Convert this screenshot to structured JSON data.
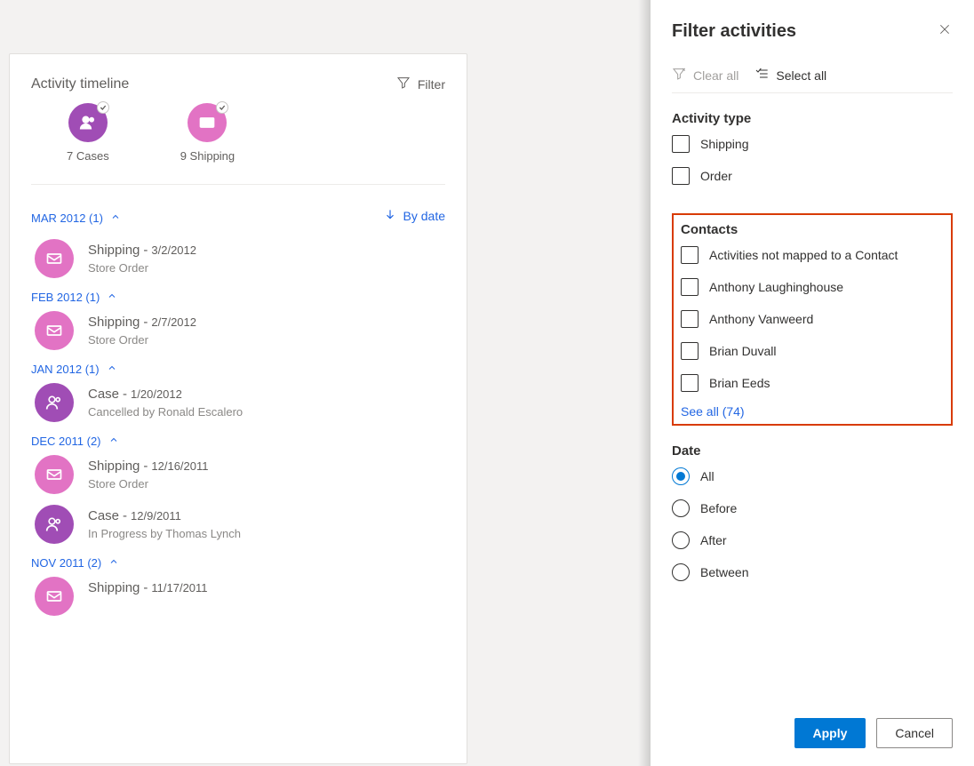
{
  "timeline": {
    "title": "Activity timeline",
    "filter_label": "Filter",
    "summary": {
      "cases": {
        "count_label": "7 Cases"
      },
      "shipping": {
        "count_label": "9 Shipping"
      }
    },
    "by_date_label": "By date",
    "groups": [
      {
        "header": "MAR 2012 (1)",
        "items": [
          {
            "type": "Shipping",
            "date": "3/2/2012",
            "sub": "Store Order",
            "icon": "ship"
          }
        ]
      },
      {
        "header": "FEB 2012 (1)",
        "items": [
          {
            "type": "Shipping",
            "date": "2/7/2012",
            "sub": "Store Order",
            "icon": "ship"
          }
        ]
      },
      {
        "header": "JAN 2012 (1)",
        "items": [
          {
            "type": "Case",
            "date": "1/20/2012",
            "sub": "Cancelled by Ronald Escalero",
            "icon": "case"
          }
        ]
      },
      {
        "header": "DEC 2011 (2)",
        "items": [
          {
            "type": "Shipping",
            "date": "12/16/2011",
            "sub": "Store Order",
            "icon": "ship"
          },
          {
            "type": "Case",
            "date": "12/9/2011",
            "sub": "In Progress by Thomas Lynch",
            "icon": "case"
          }
        ]
      },
      {
        "header": "NOV 2011 (2)",
        "items": [
          {
            "type": "Shipping",
            "date": "11/17/2011",
            "sub": "",
            "icon": "ship"
          }
        ]
      }
    ]
  },
  "panel": {
    "title": "Filter activities",
    "clear_all": "Clear all",
    "select_all": "Select all",
    "sections": {
      "activity_type": {
        "title": "Activity type",
        "options": [
          "Shipping",
          "Order"
        ]
      },
      "contacts": {
        "title": "Contacts",
        "options": [
          "Activities not mapped to a Contact",
          "Anthony Laughinghouse",
          "Anthony Vanweerd",
          "Brian Duvall",
          "Brian Eeds"
        ],
        "see_all": "See all (74)"
      },
      "date": {
        "title": "Date",
        "options": [
          "All",
          "Before",
          "After",
          "Between"
        ],
        "selected": "All"
      }
    },
    "apply": "Apply",
    "cancel": "Cancel"
  }
}
